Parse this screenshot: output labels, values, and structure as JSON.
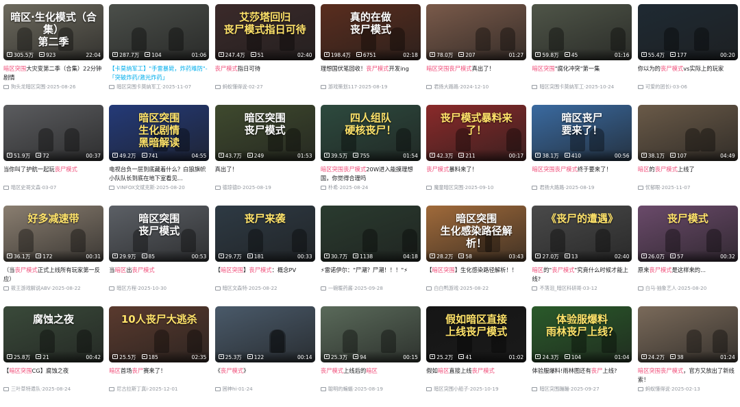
{
  "videos": [
    {
      "thumb_text": "暗区·生化模式（合集）\n第二季",
      "thumb_bg": "#6d6a5e",
      "views": "305.5万",
      "danmaku": "923",
      "duration": "22:04",
      "title": [
        {
          "t": "暗区突围",
          "k": 1
        },
        {
          "t": "大灾变第二季（合集）22分钟剧情"
        }
      ],
      "uploader": "狗头龙暗区突围",
      "date": "2025-08-26"
    },
    {
      "thumb_text": "",
      "thumb_bg": "#4b4f4a",
      "views": "287.7万",
      "danmaku": "104",
      "duration": "01:06",
      "title": [
        {
          "t": "【卡莫纳军工】\"手雷暴毙，炸药难防\"-「突破炸药/激光炸药」",
          "k": 2
        }
      ],
      "uploader": "暗区突围卡莫纳军工",
      "date": "2025-11-07"
    },
    {
      "thumb_text": "艾莎塔回归\n丧尸模式指日可待",
      "thumb_bg": "#3b2a2a",
      "views": "247.4万",
      "danmaku": "51",
      "duration": "02:40",
      "title": [
        {
          "t": "丧尸模式",
          "k": 1
        },
        {
          "t": "指日可待"
        }
      ],
      "uploader": "蚂蚁懂得说",
      "date": "02-27"
    },
    {
      "thumb_text": "真的在做\n丧尸模式",
      "thumb_bg": "#5a2d1e",
      "views": "198.4万",
      "danmaku": "6751",
      "duration": "02:18",
      "title": [
        {
          "t": "理想国伏笔回收！"
        },
        {
          "t": "丧尸模式",
          "k": 1
        },
        {
          "t": "开发ing"
        }
      ],
      "uploader": "游戏策划117",
      "date": "2025-08-19"
    },
    {
      "thumb_text": "",
      "thumb_bg": "#7a5a4a",
      "views": "78.0万",
      "danmaku": "207",
      "duration": "01:27",
      "title": [
        {
          "t": "暗区突围",
          "k": 1
        },
        {
          "t": "丧尸模式",
          "k": 1
        },
        {
          "t": "真出了！"
        }
      ],
      "uploader": "君扬大路路",
      "date": "2024-12-10"
    },
    {
      "thumb_text": "",
      "thumb_bg": "#4f5548",
      "views": "59.8万",
      "danmaku": "45",
      "duration": "01:16",
      "title": [
        {
          "t": "暗区突围",
          "k": 1
        },
        {
          "t": "\"腐化冲突\"第一集"
        }
      ],
      "uploader": "暗区突围卡莫纳军工",
      "date": "2025-10-24"
    },
    {
      "thumb_text": "",
      "thumb_bg": "#1f2a33",
      "views": "55.4万",
      "danmaku": "177",
      "duration": "00:20",
      "title": [
        {
          "t": "你以为的"
        },
        {
          "t": "丧尸模式",
          "k": 1
        },
        {
          "t": "vs实际上的玩家"
        }
      ],
      "uploader": "可爱的团长i",
      "date": "03-06"
    },
    {
      "thumb_text": "",
      "thumb_bg": "#5b5c5f",
      "views": "51.9万",
      "danmaku": "72",
      "duration": "00:37",
      "title": [
        {
          "t": "当你叫了护航一起玩"
        },
        {
          "t": "丧尸模式",
          "k": 1
        }
      ],
      "uploader": "暗区史哥文森",
      "date": "03-07"
    },
    {
      "thumb_text": "暗区突围\n生化剧情\n黑暗解读",
      "thumb_bg": "#243a78",
      "views": "49.2万",
      "danmaku": "741",
      "duration": "04:55",
      "title": [
        {
          "t": "电视台负一层到底藏着什么？白狼旗帜小队队长到底在地下室看见..."
        }
      ],
      "uploader": "VINFOX文斌克斯",
      "date": "2025-08-20"
    },
    {
      "thumb_text": "暗区突围\n丧尸模式",
      "thumb_bg": "#3f4a2e",
      "views": "43.7万",
      "danmaku": "249",
      "duration": "01:53",
      "title": [
        {
          "t": "真出了！"
        }
      ],
      "uploader": "德琼德D",
      "date": "2025-08-19"
    },
    {
      "thumb_text": "四人组队\n硬核丧尸！",
      "thumb_bg": "#2d4a3e",
      "views": "39.5万",
      "danmaku": "755",
      "duration": "01:54",
      "title": [
        {
          "t": "暗区突围丧尸模式",
          "k": 1
        },
        {
          "t": "20W进入能摸理想国，你觉得合理吗"
        }
      ],
      "uploader": "朴希",
      "date": "2025-08-24"
    },
    {
      "thumb_text": "丧尸模式暴料来了！",
      "thumb_bg": "#8a2a2a",
      "views": "42.3万",
      "danmaku": "211",
      "duration": "00:17",
      "title": [
        {
          "t": "丧尸模式",
          "k": 1
        },
        {
          "t": "暴料来了！"
        }
      ],
      "uploader": "魔童暗区突围",
      "date": "2025-09-10"
    },
    {
      "thumb_text": "暗区丧尸\n要来了！",
      "thumb_bg": "#3a6aa0",
      "views": "38.1万",
      "danmaku": "410",
      "duration": "00:56",
      "title": [
        {
          "t": "暗区突围丧尸模式",
          "k": 1
        },
        {
          "t": "终于要来了！"
        }
      ],
      "uploader": "君扬大路路",
      "date": "2025-08-19"
    },
    {
      "thumb_text": "",
      "thumb_bg": "#6a5a48",
      "views": "38.1万",
      "danmaku": "107",
      "duration": "04:49",
      "title": [
        {
          "t": "暗区",
          "k": 1
        },
        {
          "t": "的"
        },
        {
          "t": "丧尸模式",
          "k": 1
        },
        {
          "t": "上线了"
        }
      ],
      "uploader": "忧郁眼",
      "date": "2025-11-07"
    },
    {
      "thumb_text": "好多减速带",
      "thumb_bg": "#8a7e70",
      "views": "36.1万",
      "danmaku": "172",
      "duration": "00:31",
      "title": [
        {
          "t": "（当"
        },
        {
          "t": "丧尸模式",
          "k": 1
        },
        {
          "t": "正式上线所有玩家第一反应）"
        }
      ],
      "uploader": "筱王游戏解说ABV",
      "date": "2025-08-22"
    },
    {
      "thumb_text": "暗区突围\n丧尸模式",
      "thumb_bg": "#5c6066",
      "views": "29.9万",
      "danmaku": "85",
      "duration": "00:53",
      "title": [
        {
          "t": "当"
        },
        {
          "t": "暗区",
          "k": 1
        },
        {
          "t": "出"
        },
        {
          "t": "丧尸模式",
          "k": 1
        }
      ],
      "uploader": "暗区方程",
      "date": "2025-10-30"
    },
    {
      "thumb_text": "丧尸来袭",
      "thumb_bg": "#2e3a44",
      "views": "29.7万",
      "danmaku": "181",
      "duration": "00:33",
      "title": [
        {
          "t": "【"
        },
        {
          "t": "暗区突围",
          "k": 1
        },
        {
          "t": "】"
        },
        {
          "t": "丧尸模式",
          "k": 1
        },
        {
          "t": "：概念PV"
        }
      ],
      "uploader": "暗区文森特",
      "date": "2025-08-22"
    },
    {
      "thumb_text": "",
      "thumb_bg": "#2a3b2f",
      "views": "30.7万",
      "danmaku": "1138",
      "duration": "04:18",
      "title": [
        {
          "t": "⚡雷诺伊尔：\"尸潮？尸潮！！！\"⚡"
        }
      ],
      "uploader": "一碗暖药酱",
      "date": "2025-09-28"
    },
    {
      "thumb_text": "暗区突围\n生化感染路径解析！",
      "thumb_bg": "#a06a3a",
      "views": "28.2万",
      "danmaku": "58",
      "duration": "03:43",
      "title": [
        {
          "t": "【"
        },
        {
          "t": "暗区突围",
          "k": 1
        },
        {
          "t": "】生化感染路径解析！！"
        }
      ],
      "uploader": "白白鸭游戏",
      "date": "2025-08-22"
    },
    {
      "thumb_text": "《丧尸的遭遇》",
      "thumb_bg": "#4a4a4a",
      "views": "27.0万",
      "danmaku": "13",
      "duration": "02:40",
      "title": [
        {
          "t": "暗区",
          "k": 1
        },
        {
          "t": "的\""
        },
        {
          "t": "丧尸模式",
          "k": 1
        },
        {
          "t": "\"究竟什么时候才能上线?"
        }
      ],
      "uploader": "不落泪_暗区科研哥",
      "date": "03-12"
    },
    {
      "thumb_text": "丧尸模式",
      "thumb_bg": "#6a4a6a",
      "views": "26.0万",
      "danmaku": "57",
      "duration": "00:32",
      "title": [
        {
          "t": "原来"
        },
        {
          "t": "丧尸模式",
          "k": 1
        },
        {
          "t": "是这样来的..."
        }
      ],
      "uploader": "白马·抽象艺人",
      "date": "2025-08-20"
    },
    {
      "thumb_text": "腐蚀之夜",
      "thumb_bg": "#3a4a3a",
      "views": "25.8万",
      "danmaku": "21",
      "duration": "00:42",
      "title": [
        {
          "t": "【"
        },
        {
          "t": "暗区突围",
          "k": 1
        },
        {
          "t": "CG】腐蚀之夜"
        }
      ],
      "uploader": "三叶草特遣队",
      "date": "2025-08-24"
    },
    {
      "thumb_text": "10人丧尸大逃杀",
      "thumb_bg": "#5a3a2e",
      "views": "25.5万",
      "danmaku": "185",
      "duration": "02:35",
      "title": [
        {
          "t": "暗区",
          "k": 1
        },
        {
          "t": "首场"
        },
        {
          "t": "丧尸",
          "k": 1
        },
        {
          "t": "赛来了！"
        }
      ],
      "uploader": "尼古拉斯丁真i",
      "date": "2025-12-01"
    },
    {
      "thumb_text": "",
      "thumb_bg": "#4a5a6a",
      "views": "25.3万",
      "danmaku": "122",
      "duration": "00:14",
      "title": [
        {
          "t": "《"
        },
        {
          "t": "丧尸模式",
          "k": 1
        },
        {
          "t": "》"
        }
      ],
      "uploader": "困神hi",
      "date": "01-24"
    },
    {
      "thumb_text": "",
      "thumb_bg": "#5a6a5a",
      "views": "25.3万",
      "danmaku": "94",
      "duration": "00:15",
      "title": [
        {
          "t": "丧尸模式",
          "k": 1
        },
        {
          "t": "上线后的"
        },
        {
          "t": "暗区",
          "k": 1
        }
      ],
      "uploader": "聪明的蝙蝠",
      "date": "2025-08-19"
    },
    {
      "thumb_text": "假如暗区直接\n上线丧尸模式",
      "thumb_bg": "#151515",
      "views": "25.2万",
      "danmaku": "41",
      "duration": "01:02",
      "title": [
        {
          "t": "假如"
        },
        {
          "t": "暗区",
          "k": 1
        },
        {
          "t": "直接上线"
        },
        {
          "t": "丧尸模式",
          "k": 1
        }
      ],
      "uploader": "暗区突围小船子",
      "date": "2025-10-19"
    },
    {
      "thumb_text": "体验服爆料\n雨林丧尸上线？",
      "thumb_bg": "#2a5a2a",
      "views": "24.3万",
      "danmaku": "104",
      "duration": "01:04",
      "title": [
        {
          "t": "体验服爆料!雨林图还有"
        },
        {
          "t": "丧尸",
          "k": 1
        },
        {
          "t": "上线?"
        }
      ],
      "uploader": "暗区突围蹦蹦",
      "date": "2025-09-27"
    },
    {
      "thumb_text": "",
      "thumb_bg": "#7a6a5a",
      "views": "24.2万",
      "danmaku": "38",
      "duration": "01:24",
      "title": [
        {
          "t": "暗区突围丧尸模式",
          "k": 1
        },
        {
          "t": "，官方又放出了新线索！"
        }
      ],
      "uploader": "蚂蚁懂得说",
      "date": "2025-02-13"
    }
  ]
}
